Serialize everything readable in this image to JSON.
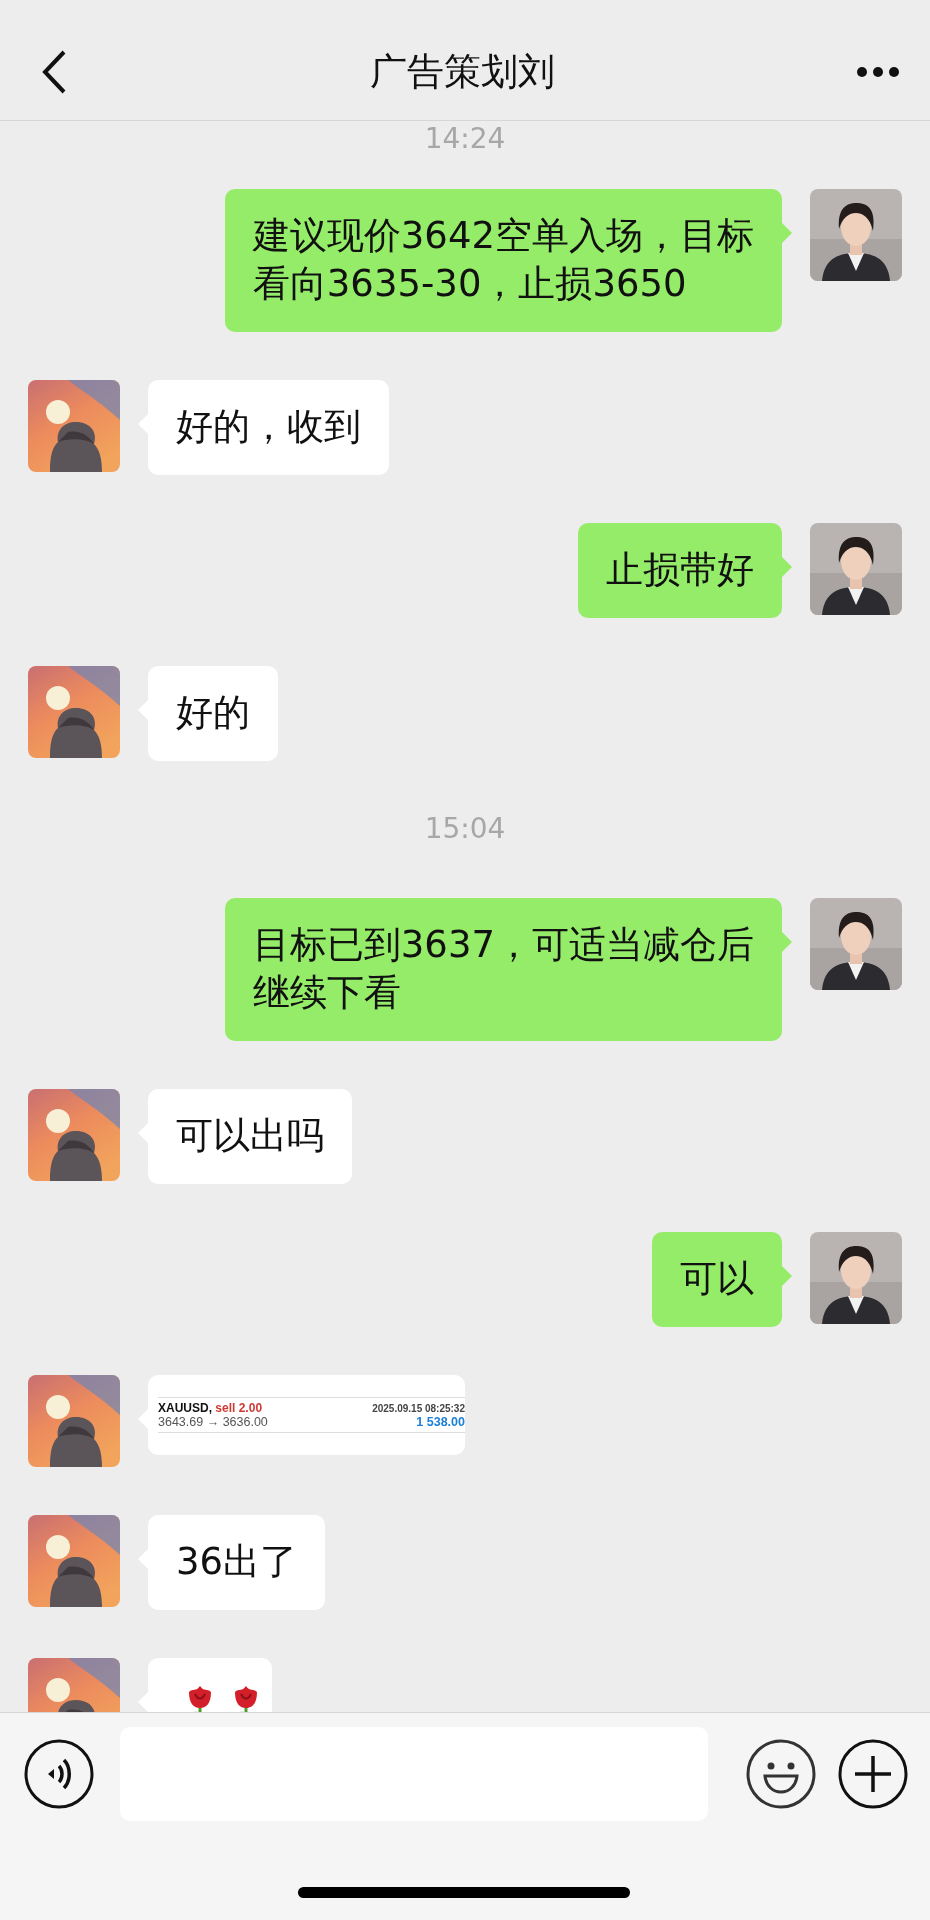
{
  "header": {
    "title": "广告策划刘"
  },
  "messages": [
    {
      "kind": "time",
      "text": "14:24"
    },
    {
      "kind": "text",
      "outgoing": true,
      "lines": [
        "建议现价3642空单入场，目标",
        "看向3635-30，止损3650"
      ]
    },
    {
      "kind": "text",
      "outgoing": false,
      "lines": [
        "好的，收到"
      ]
    },
    {
      "kind": "text",
      "outgoing": true,
      "lines": [
        "止损带好"
      ]
    },
    {
      "kind": "text",
      "outgoing": false,
      "lines": [
        "好的"
      ]
    },
    {
      "kind": "time",
      "text": "15:04"
    },
    {
      "kind": "text",
      "outgoing": true,
      "lines": [
        "目标已到3637，可适当减仓后",
        "继续下看"
      ]
    },
    {
      "kind": "text",
      "outgoing": false,
      "lines": [
        "可以出吗"
      ]
    },
    {
      "kind": "text",
      "outgoing": true,
      "lines": [
        "可以"
      ]
    },
    {
      "kind": "trade",
      "outgoing": false,
      "symbol": "XAUUSD,",
      "action": "sell 2.00",
      "time": "2025.09.15 08:25:32",
      "prices": "3643.69 → 3636.00",
      "profit": "1 538.00"
    },
    {
      "kind": "text",
      "outgoing": false,
      "lines": [
        "36出了"
      ]
    },
    {
      "kind": "roses",
      "outgoing": false
    }
  ]
}
